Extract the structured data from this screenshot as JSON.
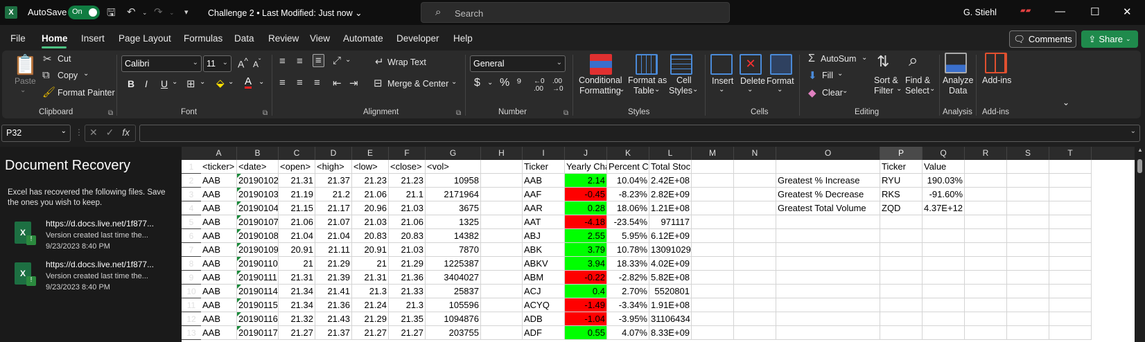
{
  "titlebar": {
    "app_logo": "X",
    "autosave_label": "AutoSave",
    "autosave_state": "On",
    "doc_title": "Challenge 2 • Last Modified: Just now ⌄",
    "search_placeholder": "Search",
    "user_name": "G. Stiehl"
  },
  "menu": {
    "tabs": [
      "File",
      "Home",
      "Insert",
      "Page Layout",
      "Formulas",
      "Data",
      "Review",
      "View",
      "Automate",
      "Developer",
      "Help"
    ],
    "comments_label": "Comments",
    "share_label": "Share"
  },
  "ribbon": {
    "clipboard": {
      "paste": "Paste",
      "cut": "Cut",
      "copy": "Copy",
      "format_painter": "Format Painter",
      "label": "Clipboard"
    },
    "font": {
      "family": "Calibri",
      "size": "11",
      "label": "Font"
    },
    "alignment": {
      "wrap_text": "Wrap Text",
      "merge_center": "Merge & Center",
      "label": "Alignment"
    },
    "number": {
      "format": "General",
      "label": "Number"
    },
    "styles": {
      "conditional": "Conditional",
      "formatting": "Formatting",
      "format_as": "Format as",
      "table": "Table",
      "cell": "Cell",
      "cell_styles": "Styles",
      "label": "Styles"
    },
    "cells": {
      "insert": "Insert",
      "delete": "Delete",
      "format": "Format",
      "label": "Cells"
    },
    "editing": {
      "autosum": "AutoSum",
      "fill": "Fill",
      "clear": "Clear",
      "sort": "Sort &",
      "filter": "Filter",
      "find": "Find &",
      "select": "Select",
      "label": "Editing"
    },
    "analysis": {
      "analyze": "Analyze",
      "data": "Data",
      "label": "Analysis"
    },
    "addins": {
      "addins": "Add-ins",
      "label": "Add-ins"
    }
  },
  "formula_bar": {
    "name_box": "P32",
    "fx": "fx"
  },
  "recovery": {
    "title": "Document Recovery",
    "description": "Excel has recovered the following files.  Save the ones you wish to keep.",
    "files": [
      {
        "url": "https://d.docs.live.net/1f877...",
        "version": "Version created last time the...",
        "time": "9/23/2023 8:40 PM"
      },
      {
        "url": "https://d.docs.live.net/1f877...",
        "version": "Version created last time the...",
        "time": "9/23/2023 8:40 PM"
      }
    ]
  },
  "grid": {
    "columns": [
      "A",
      "B",
      "C",
      "D",
      "E",
      "F",
      "G",
      "H",
      "I",
      "J",
      "K",
      "L",
      "M",
      "N",
      "O",
      "P",
      "Q",
      "R",
      "S",
      "T"
    ],
    "selected_column": "P",
    "rows": [
      "1",
      "2",
      "3",
      "4",
      "5",
      "6",
      "7",
      "8",
      "9",
      "10",
      "11",
      "12",
      "13"
    ],
    "header_row": [
      "<ticker>",
      "<date>",
      "<open>",
      "<high>",
      "<low>",
      "<close>",
      "<vol>"
    ],
    "data": [
      [
        "AAB",
        "20190102",
        "21.31",
        "21.37",
        "21.23",
        "21.23",
        "10958"
      ],
      [
        "AAB",
        "20190103",
        "21.19",
        "21.2",
        "21.06",
        "21.1",
        "2171964"
      ],
      [
        "AAB",
        "20190104",
        "21.15",
        "21.17",
        "20.96",
        "21.03",
        "3675"
      ],
      [
        "AAB",
        "20190107",
        "21.06",
        "21.07",
        "21.03",
        "21.06",
        "1325"
      ],
      [
        "AAB",
        "20190108",
        "21.04",
        "21.04",
        "20.83",
        "20.83",
        "14382"
      ],
      [
        "AAB",
        "20190109",
        "20.91",
        "21.11",
        "20.91",
        "21.03",
        "7870"
      ],
      [
        "AAB",
        "20190110",
        "21",
        "21.29",
        "21",
        "21.29",
        "1225387"
      ],
      [
        "AAB",
        "20190111",
        "21.31",
        "21.39",
        "21.31",
        "21.36",
        "3404027"
      ],
      [
        "AAB",
        "20190114",
        "21.34",
        "21.41",
        "21.3",
        "21.33",
        "25837"
      ],
      [
        "AAB",
        "20190115",
        "21.34",
        "21.36",
        "21.24",
        "21.3",
        "105596"
      ],
      [
        "AAB",
        "20190116",
        "21.32",
        "21.43",
        "21.29",
        "21.35",
        "1094876"
      ],
      [
        "AAB",
        "20190117",
        "21.27",
        "21.37",
        "21.27",
        "21.27",
        "203755"
      ]
    ],
    "summary_headers": [
      "Ticker",
      "Yearly Cha",
      "Percent Ch",
      "Total Stock Volume"
    ],
    "summary": [
      [
        "AAB",
        "2.14",
        "10.04%",
        "2.42E+08"
      ],
      [
        "AAF",
        "-0.45",
        "-8.23%",
        "2.82E+09"
      ],
      [
        "AAR",
        "0.28",
        "18.06%",
        "1.21E+08"
      ],
      [
        "AAT",
        "-4.18",
        "-23.54%",
        "971117"
      ],
      [
        "ABJ",
        "2.55",
        "5.95%",
        "6.12E+09"
      ],
      [
        "ABK",
        "3.79",
        "10.78%",
        "13091029"
      ],
      [
        "ABKV",
        "3.94",
        "18.33%",
        "4.02E+09"
      ],
      [
        "ABM",
        "-0.22",
        "-2.82%",
        "5.82E+08"
      ],
      [
        "ACJ",
        "0.4",
        "2.70%",
        "5520801"
      ],
      [
        "ACYQ",
        "-1.49",
        "-3.34%",
        "1.91E+08"
      ],
      [
        "ADB",
        "-1.04",
        "-3.95%",
        "31106434"
      ],
      [
        "ADF",
        "0.55",
        "4.07%",
        "8.33E+09"
      ]
    ],
    "greatest_headers": [
      "Ticker",
      "Value"
    ],
    "greatest": [
      [
        "Greatest % Increase",
        "RYU",
        "190.03%"
      ],
      [
        "Greatest % Decrease",
        "RKS",
        "-91.60%"
      ],
      [
        "Greatest Total Volume",
        "ZQD",
        "4.37E+12"
      ]
    ]
  },
  "colors": {
    "positive": "#00ff00",
    "negative": "#ff0000",
    "accent": "#107c41"
  }
}
